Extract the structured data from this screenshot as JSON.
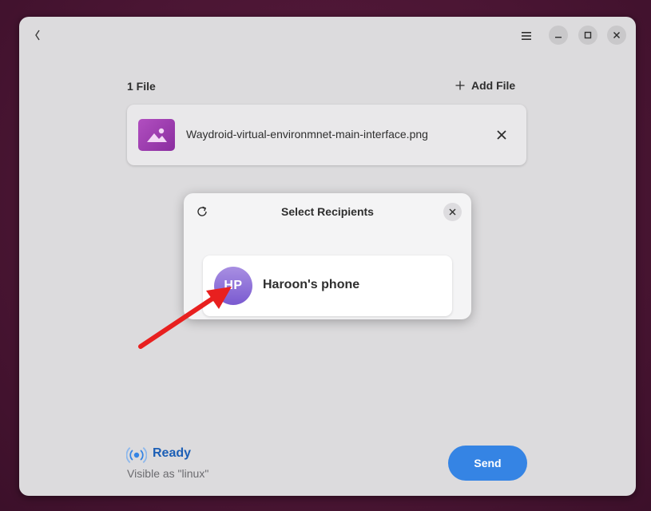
{
  "files": {
    "count_label": "1 File",
    "add_label": "Add File",
    "items": [
      {
        "name": "Waydroid-virtual-environmnet-main-interface.png",
        "icon": "image-file-icon"
      }
    ]
  },
  "dialog": {
    "title": "Select Recipients",
    "recipients": [
      {
        "initials": "HP",
        "name": "Haroon's phone"
      }
    ]
  },
  "status": {
    "label": "Ready",
    "visibility": "Visible as \"linux\""
  },
  "actions": {
    "send_label": "Send"
  },
  "colors": {
    "accent": "#3584e4",
    "ready": "#1c5fb6",
    "annotation_arrow": "#e8201f"
  }
}
